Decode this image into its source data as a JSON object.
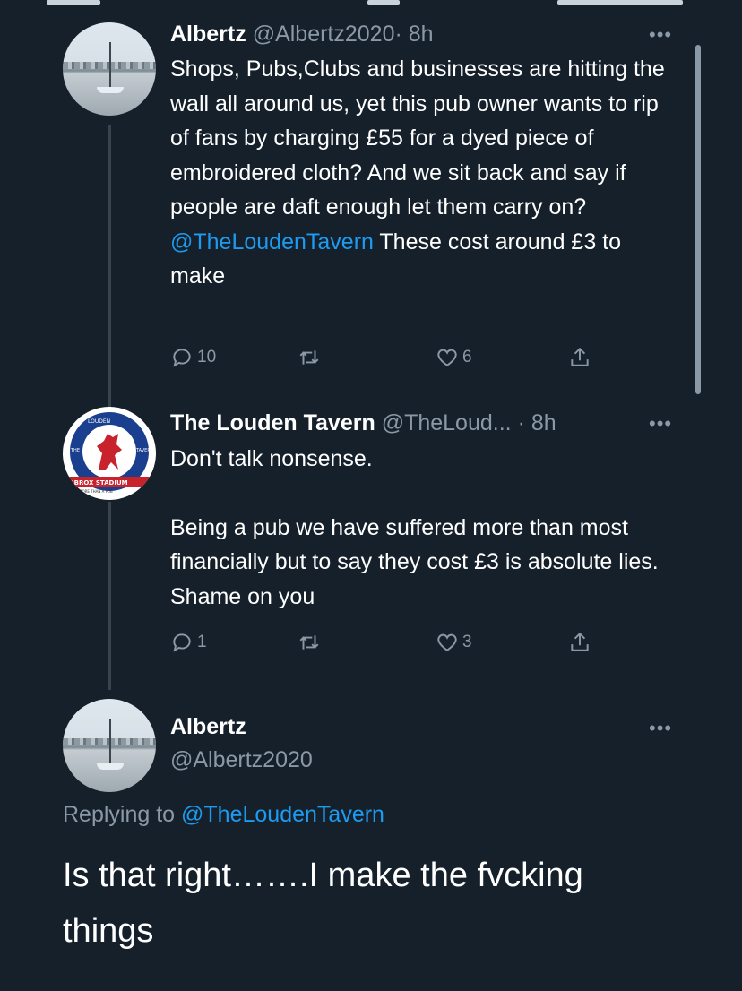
{
  "theme": {
    "background": "#15202b",
    "text": "#ffffff",
    "secondary": "#8b98a5",
    "accent": "#1d9bf0",
    "divider": "#38444d"
  },
  "tweets": [
    {
      "name": "Albertz",
      "handle": "@Albertz2020",
      "time": "· 8h",
      "avatar_icon": "harbour-photo-avatar",
      "text_1": "Shops, Pubs,Clubs and businesses are hitting the wall all around us, yet this pub owner wants to rip of fans by charging £55 for a dyed piece of embroidered cloth? And we sit back and say if people are daft enough let them carry on? ",
      "mention": "@TheLoudenTavern",
      "text_2": " These cost around £3 to make",
      "replies": "10",
      "retweets": "",
      "likes": "6"
    },
    {
      "name": "The Louden Tavern",
      "handle": "@TheLoud...",
      "time": "· 8h",
      "avatar_icon": "louden-tavern-logo-avatar",
      "logo_text_top": "LOUDEN",
      "logo_text_left": "THE",
      "logo_text_right": "TAVERN",
      "logo_banner": "IBROX STADIUM",
      "logo_subbanner": "MORE THAN A PUB",
      "para_1": "Don't talk nonsense.",
      "para_2": "Being a pub we have suffered more than most financially but to say they cost £3 is absolute lies.  Shame on you",
      "replies": "1",
      "retweets": "",
      "likes": "3"
    }
  ],
  "main_tweet": {
    "name": "Albertz",
    "handle": "@Albertz2020",
    "replying_label": "Replying to ",
    "replying_to": "@TheLoudenTavern",
    "text": "Is that right…….I make the fvcking things"
  }
}
